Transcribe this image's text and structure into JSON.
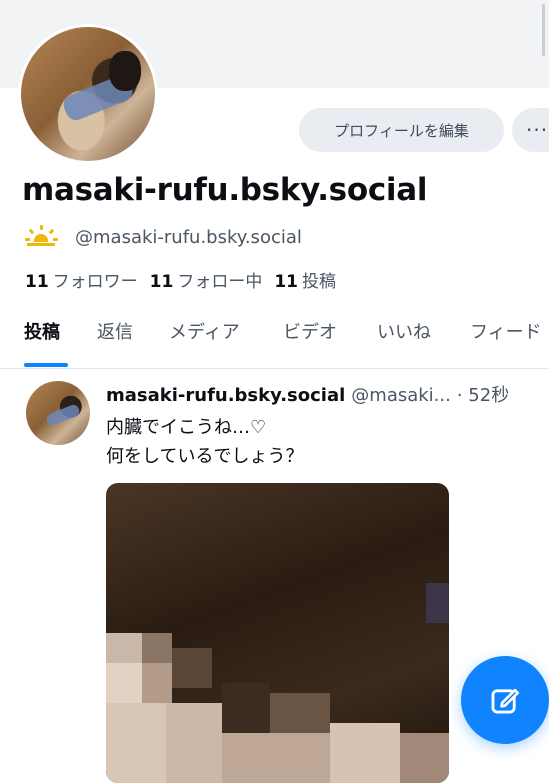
{
  "profile": {
    "display_name": "masaki-rufu.bsky.social",
    "handle": "@masaki-rufu.bsky.social",
    "edit_button": "プロフィールを編集",
    "more_button": "···",
    "stats": {
      "followers_count": "11",
      "followers_label": "フォロワー",
      "following_count": "11",
      "following_label": "フォロー中",
      "posts_count": "11",
      "posts_label": "投稿"
    },
    "handle_icon": "sun-icon"
  },
  "tabs": [
    {
      "label": "投稿",
      "active": true
    },
    {
      "label": "返信",
      "active": false
    },
    {
      "label": "メディア",
      "active": false
    },
    {
      "label": "ビデオ",
      "active": false
    },
    {
      "label": "いいね",
      "active": false
    },
    {
      "label": "フィード",
      "active": false
    }
  ],
  "post": {
    "author_name": "masaki-rufu.bsky.social",
    "author_handle": "@masaki...",
    "time": "· 52秒",
    "text": "内臓でイこうね…♡\n何をしているでしょう？"
  },
  "colors": {
    "accent": "#1083fe",
    "banner": "#f1f3f5",
    "button_bg": "#e9edf2",
    "text_secondary": "#4b5663"
  },
  "icons": {
    "compose": "edit-icon",
    "more": "ellipsis-icon"
  }
}
